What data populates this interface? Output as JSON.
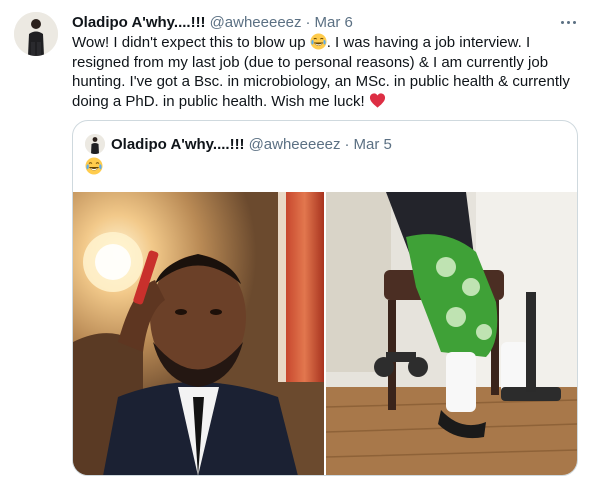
{
  "tweet": {
    "display_name": "Oladipo A'why....!!!",
    "handle": "@awheeeeez",
    "separator": "·",
    "date": "Mar 6",
    "text_part1": "Wow! I didn't expect this to blow up ",
    "text_part2": ". I was having a job interview. I resigned from my last job (due to personal reasons) & I am currently job hunting. I've got a Bsc. in microbiology, an MSc. in public health & currently doing a PhD. in public health. Wish me luck! ",
    "emoji_1": "face-with-tears-of-joy",
    "emoji_2": "red-heart",
    "more_icon": "more-horizontal-icon"
  },
  "quoted_tweet": {
    "display_name": "Oladipo A'why....!!!",
    "handle": "@awheeeeez",
    "separator": "·",
    "date": "Mar 5",
    "emoji": "face-with-tears-of-joy",
    "photos": [
      {
        "subject": "selfie of man in suit and tie holding phone"
      },
      {
        "subject": "feet in white socks and sandals under a desk chair"
      }
    ]
  },
  "colors": {
    "text_primary": "#0f1419",
    "text_secondary": "#5b7083",
    "border": "#cfd9de",
    "heart": "#e0245e"
  }
}
